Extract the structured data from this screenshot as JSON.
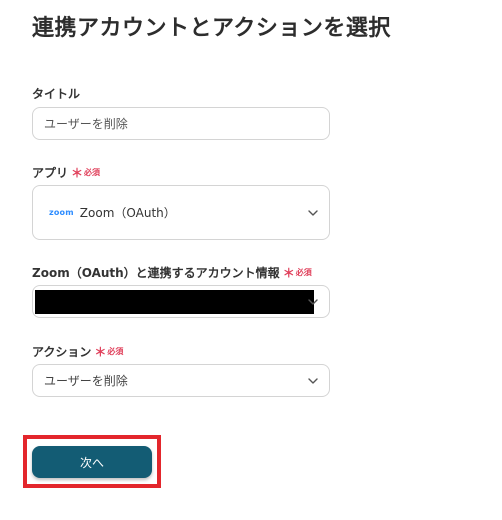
{
  "page": {
    "title": "連携アカウントとアクションを選択"
  },
  "fields": {
    "title": {
      "label": "タイトル",
      "value": "ユーザーを削除"
    },
    "app": {
      "label": "アプリ",
      "required_mark": "＊",
      "required_text": "必須",
      "logo_text": "zoom",
      "selected_value": "Zoom（OAuth）"
    },
    "account": {
      "label": "Zoom（OAuth）と連携するアカウント情報",
      "required_mark": "＊",
      "required_text": "必須"
    },
    "action": {
      "label": "アクション",
      "required_mark": "＊",
      "required_text": "必須",
      "selected_value": "ユーザーを削除"
    }
  },
  "buttons": {
    "next_label": "次へ"
  },
  "colors": {
    "primary_button": "#135c74",
    "highlight_border": "#e3262c",
    "required": "#e0405b",
    "zoom_brand": "#2d8cff"
  }
}
